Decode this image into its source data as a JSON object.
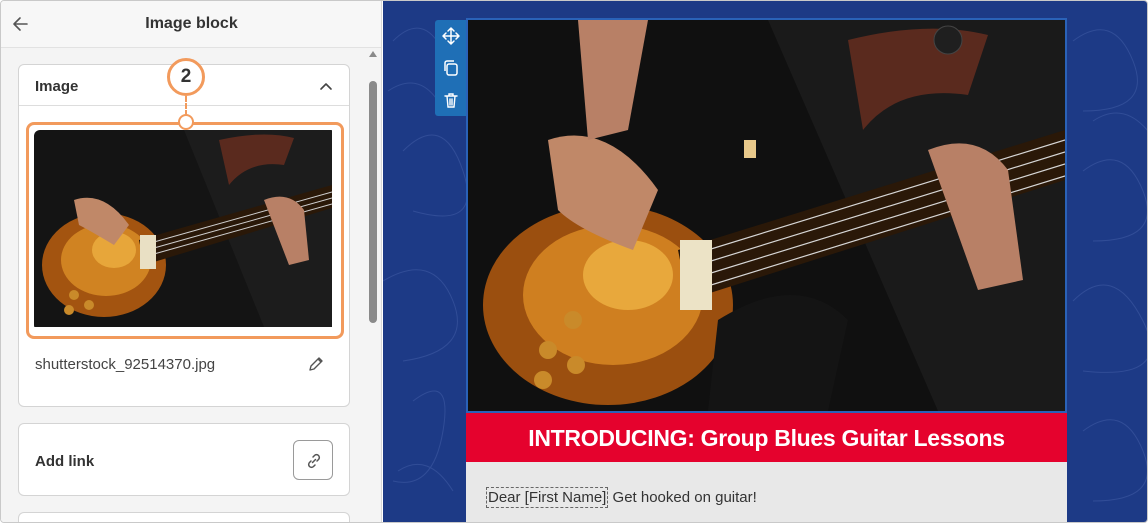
{
  "panel": {
    "title": "Image block",
    "image_section": {
      "title": "Image",
      "filename": "shutterstock_92514370.jpg"
    },
    "link_section": {
      "title": "Add link"
    }
  },
  "callout": {
    "step": "2"
  },
  "email": {
    "banner_text": "INTRODUCING: Group Blues Guitar Lessons",
    "greeting_tag": "Dear [First Name]",
    "greeting_rest": " Get hooked on guitar!"
  },
  "colors": {
    "accent_orange": "#f29a5c",
    "canvas_blue": "#1d3a86",
    "toolbar_blue": "#1f6fb6",
    "banner_red": "#e5022d"
  },
  "icons": [
    "arrow-left-icon",
    "chevron-up-icon",
    "pencil-icon",
    "link-icon",
    "move-icon",
    "duplicate-icon",
    "trash-icon"
  ]
}
